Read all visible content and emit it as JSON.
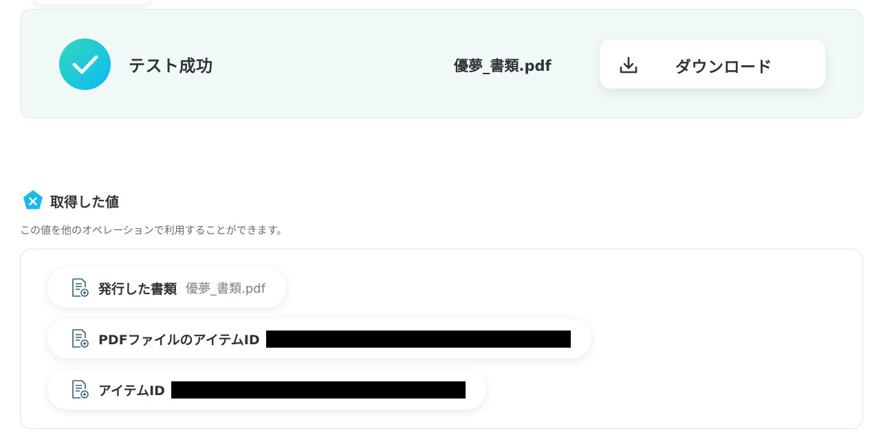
{
  "test_result": {
    "status_label": "テスト成功",
    "file_name": "優夢_書類.pdf",
    "download_label": "ダウンロード"
  },
  "acquired_values": {
    "title": "取得した値",
    "description": "この値を他のオペレーションで利用することができます。",
    "items": [
      {
        "label": "発行した書類",
        "value": "優夢_書類.pdf",
        "redacted": false
      },
      {
        "label": "PDFファイルのアイテムID",
        "value": "",
        "redacted": true
      },
      {
        "label": "アイテムID",
        "value": "",
        "redacted": true
      }
    ]
  },
  "icons": {
    "success": "check-icon",
    "download": "download-icon",
    "values": "variable-pentagon-icon",
    "item": "document-add-icon"
  },
  "colors": {
    "success_gradient_start": "#33d6b6",
    "success_gradient_end": "#10b6ee",
    "card_background": "#f1f9f8",
    "values_icon": "#1cb8e8",
    "doc_icon_stroke": "#2f5f73"
  }
}
